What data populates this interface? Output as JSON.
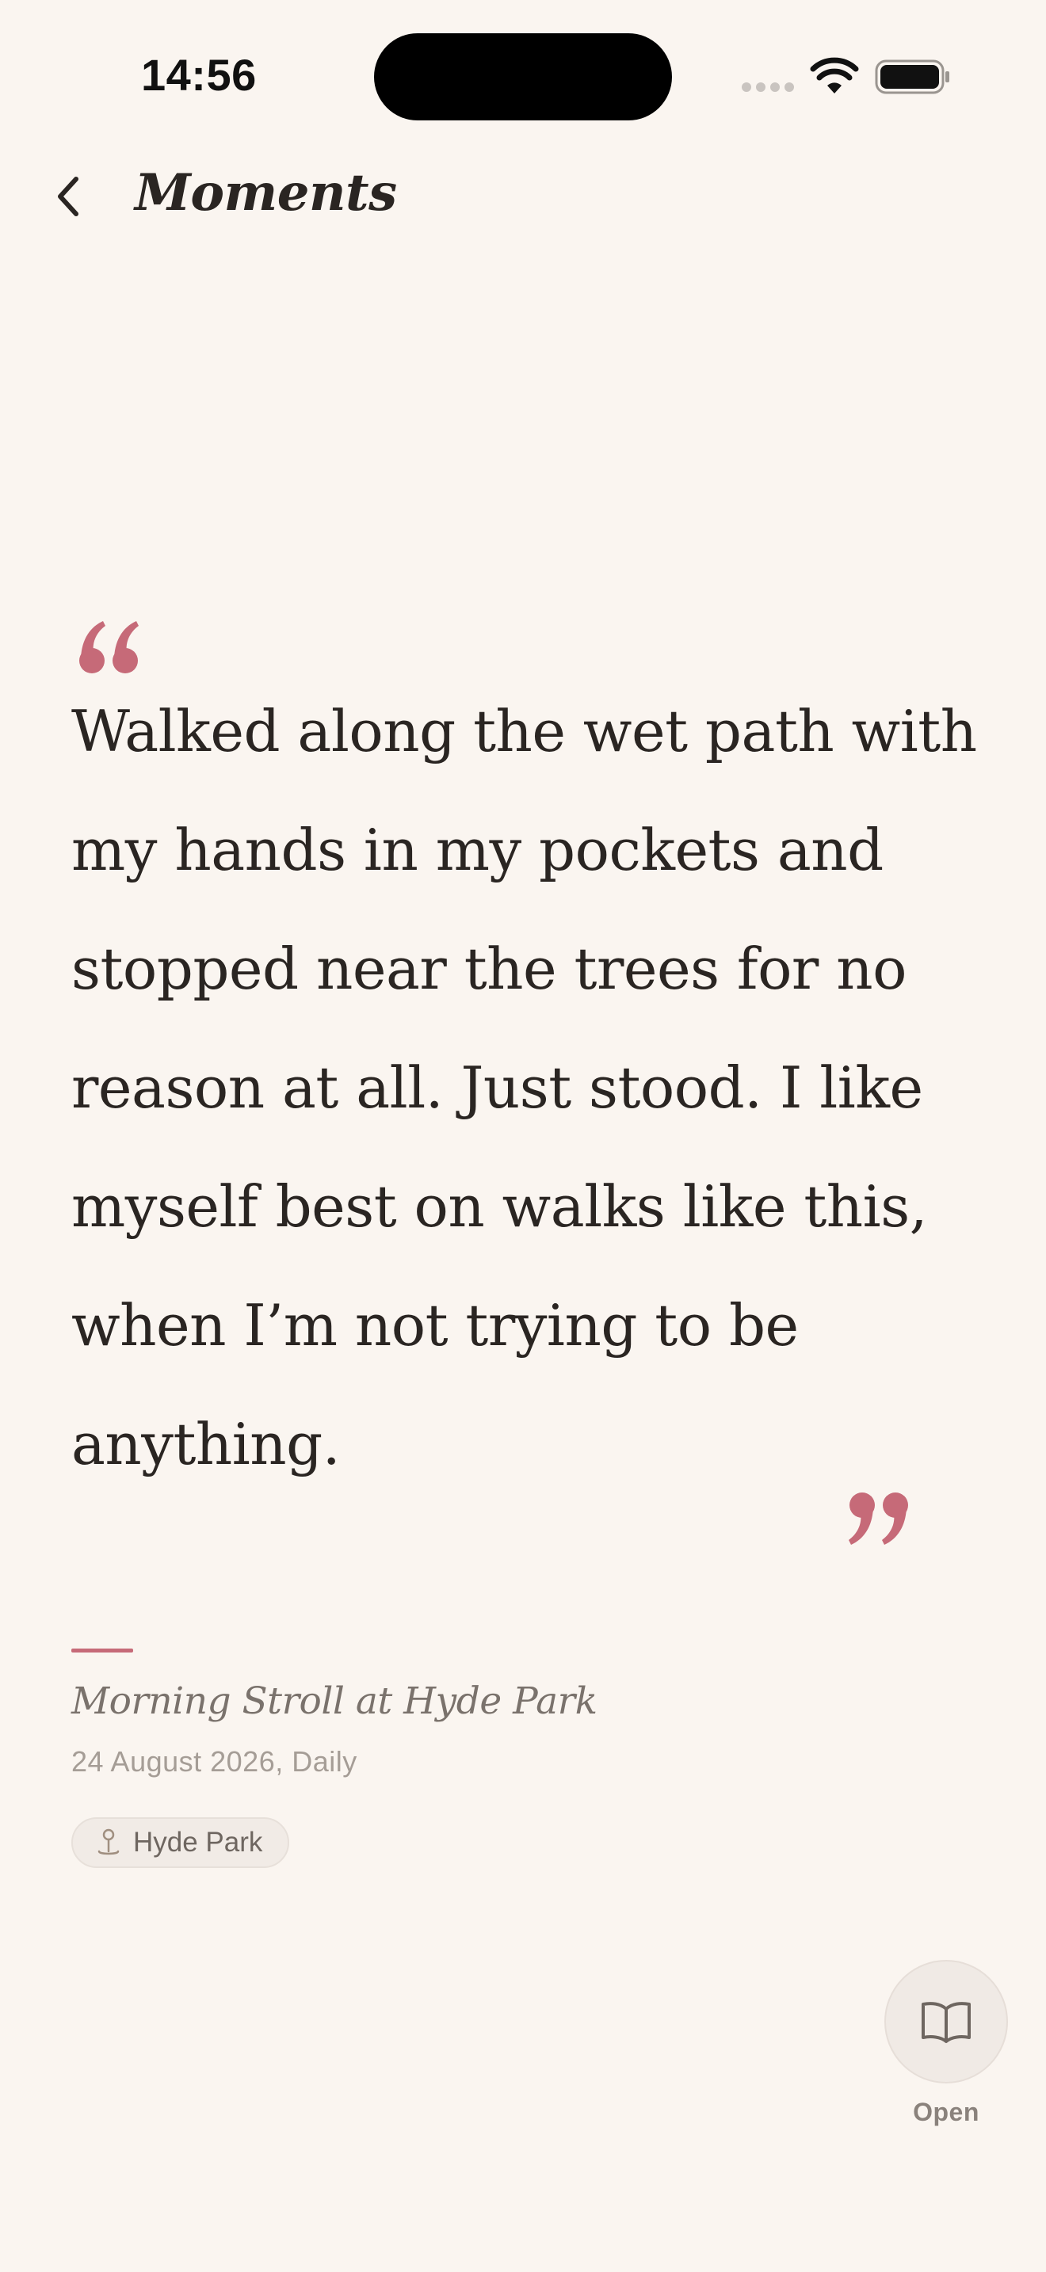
{
  "status_bar": {
    "time": "14:56",
    "icons": [
      "cellular-signal-icon",
      "wifi-icon",
      "battery-icon"
    ]
  },
  "nav": {
    "back_icon": "chevron-left-icon",
    "title": "Moments"
  },
  "quote": {
    "text": "Walked along the wet path with my hands in my pockets and stopped near the trees for no reason at all. Just stood. I like myself best on walks like this, when I’m not trying to be anything.",
    "accent_color": "#C66A78"
  },
  "entry": {
    "title": "Morning Stroll at Hyde Park",
    "date": "24 August 2026,",
    "category": "Daily",
    "location": {
      "icon": "map-pin-icon",
      "label": "Hyde Park"
    }
  },
  "action": {
    "icon": "open-book-icon",
    "label": "Open"
  }
}
